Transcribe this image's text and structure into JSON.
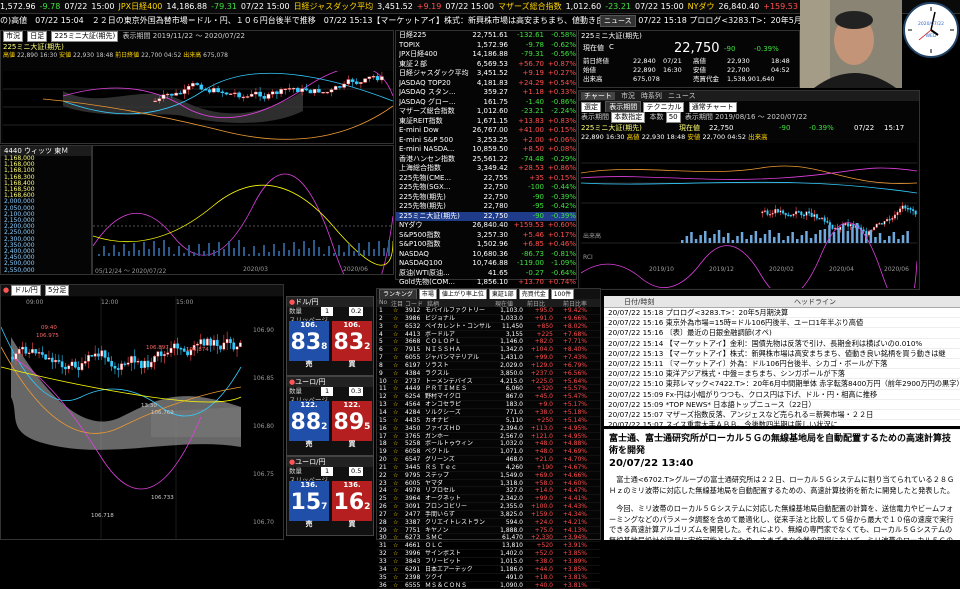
{
  "ticker": [
    {
      "t": "1,572.96",
      "c": "wh"
    },
    {
      "t": "-9.78",
      "c": "dn"
    },
    {
      "t": "07/22",
      "c": "wh"
    },
    {
      "t": "15:00",
      "c": "wh"
    },
    {
      "t": "JPX日経400",
      "c": "yl"
    },
    {
      "t": "14,186.88",
      "c": "wh"
    },
    {
      "t": "-79.31",
      "c": "dn"
    },
    {
      "t": "07/22 15:00",
      "c": "wh"
    },
    {
      "t": "日経ジャスダック平均",
      "c": "yl"
    },
    {
      "t": "3,451.52",
      "c": "wh"
    },
    {
      "t": "+9.19",
      "c": "up"
    },
    {
      "t": "07/22 15:00",
      "c": "wh"
    },
    {
      "t": "マザーズ総合指数",
      "c": "yl"
    },
    {
      "t": "1,012.60",
      "c": "wh"
    },
    {
      "t": "-23.21",
      "c": "dn"
    },
    {
      "t": "07/22 15:00",
      "c": "wh"
    },
    {
      "t": "NYダウ",
      "c": "yl"
    },
    {
      "t": "26,840.40",
      "c": "wh"
    },
    {
      "t": "+159.53",
      "c": "up"
    },
    {
      "t": "07/22 06:00",
      "c": "wh"
    },
    {
      "t": "NASDAQ",
      "c": "yl"
    }
  ],
  "ticker2": "の)高値　07/22 15:04　２２日の東京外国為替市場＝ドル・円、１０６円台後半で推移　07/22 15:13【マーケットアイ】株式：新興株市場は高安まちまち、値動き良い銘柄を買う動きは継",
  "newsbar": {
    "btn": "ニュース",
    "text": "07/22 15:18 プロログ<3283.T>：20年5月期決算"
  },
  "leftchart": {
    "title": "225ミニ大証(期先)",
    "label_ashi": "表示期間",
    "label_date": "2019/11/22 ～ 2020/07/22",
    "vals": [
      "22,890",
      "16:30",
      "22,930",
      "18:48",
      "22,700",
      "04:52",
      "22,750",
      "675,078"
    ],
    "labs": [
      "高値",
      "安値",
      "前日終値",
      "出来高"
    ],
    "dates": [
      "2020/03",
      "2020/06"
    ]
  },
  "leftbox": {
    "title": "4440 ウィッツ 東Ｍ",
    "rows": [
      "1,168,000",
      "1,168,000",
      "1,168,100",
      "1,168,300",
      "1,168,400",
      "1,168,500",
      "1,168,600",
      "2,000,000",
      "2,050,000",
      "2,100,000",
      "2,150,000",
      "2,200,000",
      "2,250,000",
      "2,300,000",
      "2,350,000",
      "2,400,000",
      "2,450,000",
      "2,500,000",
      "2,550,000"
    ]
  },
  "bottomchart": {
    "title": "ドル/円",
    "ashi": "5分足",
    "times": [
      "09:00",
      "12:00",
      "15:00"
    ],
    "prices": [
      "106.90",
      "106.85",
      "106.80",
      "106.75",
      "106.70"
    ],
    "markers": [
      "09:40",
      "106.975",
      "106.897",
      "106.874",
      "13:30",
      "106.769",
      "106.733",
      "106.718"
    ],
    "footer": "05/12/24 ～ 2020/07/22"
  },
  "fx": [
    {
      "pair": "ドル/円",
      "bid_big": "83",
      "bid_small": "8",
      "ask_big": "83",
      "ask_small": "2",
      "bid_pre": "106.",
      "ask_pre": "106.",
      "spread": "0.2",
      "qty": "1"
    },
    {
      "pair": "ユーロ/円",
      "bid_big": "88",
      "bid_small": "2",
      "ask_big": "89",
      "ask_small": "5",
      "bid_pre": "122.",
      "ask_pre": "122.",
      "spread": "0.3",
      "qty": "1"
    },
    {
      "pair": "ユーロ/円",
      "bid_big": "15",
      "bid_small": "7",
      "ask_big": "16",
      "ask_small": "2",
      "bid_pre": "136.",
      "ask_pre": "136.",
      "spread": "0.5",
      "qty": "1"
    }
  ],
  "fx_labels": {
    "qty": "数量",
    "slip": "スリッページ",
    "sell": "売",
    "buy": "買"
  },
  "indices": [
    {
      "n": "日経225",
      "v": "22,751.61",
      "c": "-132.61",
      "p": "-0.58%",
      "d": true
    },
    {
      "n": "TOPIX",
      "v": "1,572.96",
      "c": "-9.78",
      "p": "-0.62%",
      "d": true
    },
    {
      "n": "JPX日経400",
      "v": "14,186.88",
      "c": "-79.31",
      "p": "-0.56%",
      "d": true
    },
    {
      "n": "東証２部",
      "v": "6,569.53",
      "c": "+56.70",
      "p": "+0.87%",
      "d": false
    },
    {
      "n": "日経ジャスダック平均",
      "v": "3,451.52",
      "c": "+9.19",
      "p": "+0.27%",
      "d": false
    },
    {
      "n": "JASDAQ TOP20",
      "v": "4,181.83",
      "c": "+24.29",
      "p": "+0.54%",
      "d": false
    },
    {
      "n": "JASDAQ スタン...",
      "v": "359.27",
      "c": "+1.18",
      "p": "+0.33%",
      "d": false
    },
    {
      "n": "JASDAQ グロー...",
      "v": "161.75",
      "c": "-1.40",
      "p": "-0.86%",
      "d": true
    },
    {
      "n": "マザーズ総合指数",
      "v": "1,012.60",
      "c": "-23.21",
      "p": "-2.24%",
      "d": true
    },
    {
      "n": "東証REIT指数",
      "v": "1,671.15",
      "c": "+13.83",
      "p": "+0.83%",
      "d": false
    },
    {
      "n": "E-mini Dow",
      "v": "26,767.00",
      "c": "+41.00",
      "p": "+0.15%",
      "d": false
    },
    {
      "n": "E-mini S&P 500",
      "v": "3,253.25",
      "c": "+2.00",
      "p": "+0.06%",
      "d": false
    },
    {
      "n": "E-mini NASDA...",
      "v": "10,859.50",
      "c": "+8.50",
      "p": "+0.08%",
      "d": false
    },
    {
      "n": "香港ハンセン指数",
      "v": "25,561.22",
      "c": "-74.48",
      "p": "-0.29%",
      "d": true
    },
    {
      "n": "上海総合指数",
      "v": "3,349.42",
      "c": "+28.53",
      "p": "+0.86%",
      "d": false
    },
    {
      "n": "225先物(CME...",
      "v": "22,755",
      "c": "+35",
      "p": "+0.15%",
      "d": false
    },
    {
      "n": "225先物(SGX...",
      "v": "22,750",
      "c": "-100",
      "p": "-0.44%",
      "d": true
    },
    {
      "n": "225先物(期先)",
      "v": "22,750",
      "c": "-90",
      "p": "-0.39%",
      "d": true
    },
    {
      "n": "225先物(期先)",
      "v": "22,780",
      "c": "-95",
      "p": "-0.42%",
      "d": true
    },
    {
      "n": "225ミニ大証(期先)",
      "v": "22,750",
      "c": "-90",
      "p": "-0.39%",
      "d": true,
      "sel": true
    },
    {
      "n": "NYダウ",
      "v": "26,840.40",
      "c": "+159.53",
      "p": "+0.60%",
      "d": false
    },
    {
      "n": "S&P500指数",
      "v": "3,257.30",
      "c": "+5.46",
      "p": "+0.17%",
      "d": false
    },
    {
      "n": "S&P100指数",
      "v": "1,502.96",
      "c": "+6.85",
      "p": "+0.46%",
      "d": false
    },
    {
      "n": "NASDAQ",
      "v": "10,680.36",
      "c": "-86.73",
      "p": "-0.81%",
      "d": true
    },
    {
      "n": "NASDAQ100",
      "v": "10,746.88",
      "c": "-119.00",
      "p": "-1.09%",
      "d": true
    },
    {
      "n": "原油(WTI原油...",
      "v": "41.65",
      "c": "-0.27",
      "p": "-0.64%",
      "d": true
    },
    {
      "n": "Gold先物(COM...",
      "v": "1,856.10",
      "c": "+13.70",
      "p": "+0.74%",
      "d": false
    }
  ],
  "quote": {
    "title": "225ミニ大証(期先)",
    "labels": [
      "現在値",
      "前日終値",
      "始値",
      "高値",
      "安値",
      "出来高",
      "売買代金"
    ],
    "price": "22,750",
    "chg": "-90",
    "pct": "-0.39%",
    "prev": "22,840",
    "prev_t": "07/21",
    "open": "22,890",
    "open_t": "16:30",
    "high": "22,930",
    "high_t": "18:48",
    "low": "22,700",
    "low_t": "04:52",
    "vol": "675,078",
    "amt": "1,538,901,640",
    "unit": "C",
    "hi_t": "16:30",
    "lo_t": "04:52"
  },
  "rchart": {
    "tabs": [
      "チャート",
      "市況",
      "時系列",
      "ニュース"
    ],
    "sel1": "選定",
    "btn1": "表示期間",
    "sel2": "テクニカル",
    "sel3": "通常チャート",
    "lbl_period": "表示期間",
    "sel4": "本数指定",
    "lbl_count": "本数",
    "count": "50",
    "lbl_range": "表示期間",
    "range": "2019/08/16 ～ 2020/07/22",
    "name": "225ミニ大証(期先)",
    "stats": [
      "現在値",
      "22,750",
      "-90",
      "-0.39%",
      "07/22",
      "15:17"
    ],
    "stats2": [
      "22,890",
      "16:30",
      "高値",
      "22,930",
      "18:48",
      "安値",
      "22,700",
      "04:52",
      "出来高"
    ],
    "vol_lbl": "出来高",
    "rci_lbl": "RCI",
    "dates": [
      "2019/10",
      "2019/12",
      "2020/02",
      "2020/04",
      "2020/06"
    ]
  },
  "rank": {
    "tabs": [
      "ランキング",
      "市場",
      "値上がり率上位",
      "東証1部",
      "売買代金",
      "100件"
    ],
    "cols": [
      "No",
      "注目",
      "コード",
      "銘柄",
      "現在値",
      "前日比",
      "前日比率"
    ],
    "rows": [
      [
        "1",
        "3912",
        "モバイルファクトリー",
        "1,103.0",
        "+95.0",
        "+9.42%"
      ],
      [
        "2",
        "3986",
        "ビジョナル",
        "1,033.0",
        "+91.0",
        "+9.66%"
      ],
      [
        "3",
        "6532",
        "ベイカレント・コンサル",
        "11,450",
        "+850",
        "+8.02%"
      ],
      [
        "4",
        "4413",
        "ボードルア",
        "3,155",
        "+225",
        "+7.68%"
      ],
      [
        "5",
        "3668",
        "ＣＯＬＯＰＬ",
        "1,146.0",
        "+82.0",
        "+7.71%"
      ],
      [
        "6",
        "7915",
        "ＮＩＳＳＨＡ",
        "1,342.0",
        "+104.0",
        "+8.40%"
      ],
      [
        "7",
        "6055",
        "ジャパンマテリアル",
        "1,431.0",
        "+99.0",
        "+7.43%"
      ],
      [
        "8",
        "6197",
        "ソラスト",
        "2,029.0",
        "+129.0",
        "+6.79%"
      ],
      [
        "9",
        "4384",
        "ラクスル",
        "3,850.0",
        "+237.0",
        "+6.56%"
      ],
      [
        "10",
        "2737",
        "トーメンデバイス",
        "4,215.0",
        "+225.0",
        "+5.64%"
      ],
      [
        "11",
        "4449",
        "ＰＲＴＩＭＥＳ",
        "6,060",
        "+320",
        "+5.57%"
      ],
      [
        "12",
        "6254",
        "野村マイクロ",
        "867.0",
        "+45.0",
        "+5.47%"
      ],
      [
        "13",
        "4564",
        "オンコセラピ",
        "183.0",
        "+9.0",
        "+5.17%"
      ],
      [
        "14",
        "4284",
        "ソルクシーズ",
        "771.0",
        "+38.0",
        "+5.18%"
      ],
      [
        "15",
        "4435",
        "カオナビ",
        "5,110",
        "+250",
        "+5.14%"
      ],
      [
        "16",
        "3450",
        "ファイズＨＤ",
        "2,394.0",
        "+113.0",
        "+4.95%"
      ],
      [
        "17",
        "3765",
        "ガンホー",
        "2,567.0",
        "+121.0",
        "+4.95%"
      ],
      [
        "18",
        "5258",
        "ポールトゥウィン",
        "1,032.0",
        "+48.0",
        "+4.88%"
      ],
      [
        "19",
        "6058",
        "ベクトル",
        "1,071.0",
        "+48.0",
        "+4.69%"
      ],
      [
        "20",
        "6547",
        "グリーンズ",
        "468.0",
        "+21.0",
        "+4.70%"
      ],
      [
        "21",
        "3445",
        "ＲＳ Ｔｅｃ",
        "4,260",
        "+190",
        "+4.67%"
      ],
      [
        "22",
        "9795",
        "ステップ",
        "1,549.0",
        "+69.0",
        "+4.66%"
      ],
      [
        "23",
        "6005",
        "ヤマダ",
        "1,318.0",
        "+58.0",
        "+4.60%"
      ],
      [
        "24",
        "4978",
        "リプロセル",
        "327.0",
        "+14.0",
        "+4.47%"
      ],
      [
        "25",
        "3964",
        "オークネット",
        "2,342.0",
        "+99.0",
        "+4.41%"
      ],
      [
        "26",
        "3091",
        "ブロンコビリー",
        "2,355.0",
        "+100.0",
        "+4.43%"
      ],
      [
        "27",
        "2477",
        "手間いらず",
        "3,825.0",
        "+159.0",
        "+4.34%"
      ],
      [
        "28",
        "3387",
        "クリエイトレストラン",
        "594.0",
        "+24.0",
        "+4.21%"
      ],
      [
        "29",
        "7751",
        "キヤノン",
        "1,888.0",
        "+75.0",
        "+4.13%"
      ],
      [
        "30",
        "6273",
        "ＳＭＣ",
        "61,470",
        "+2,330",
        "+3.94%"
      ],
      [
        "31",
        "4661",
        "ＯＬＣ",
        "13,810",
        "+520",
        "+3.91%"
      ],
      [
        "32",
        "3996",
        "サインポスト",
        "1,402.0",
        "+52.0",
        "+3.85%"
      ],
      [
        "33",
        "3843",
        "フリービット",
        "1,015.0",
        "+38.0",
        "+3.89%"
      ],
      [
        "34",
        "6291",
        "日本エアーテック",
        "1,186.0",
        "+44.0",
        "+3.85%"
      ],
      [
        "35",
        "2398",
        "ツクイ",
        "491.0",
        "+18.0",
        "+3.81%"
      ],
      [
        "36",
        "6555",
        "ＭＳ＆ＣＯＮＳ",
        "1,090.0",
        "+40.0",
        "+3.81%"
      ]
    ]
  },
  "news_head": {
    "c1": "日付/時刻",
    "c2": "ヘッドライン"
  },
  "news": [
    "20/07/22 15:18 プロログ<3283.T>：20年5月期決算",
    "20/07/22 15:16 東京外為市場=15時=ドル106円後半、ユーロ1年半ぶり高値",
    "20/07/22 15:16 〔表〕最近の日銀金融調節(オペ)",
    "20/07/22 15:14 【マーケットアイ】金利：国債先物は反落で引け、長期金利は横ばいの0.010%",
    "20/07/22 15:13 【マーケットアイ】株式：新興株市場は高安まちまち、値動き良い銘柄を買う動きは継",
    "20/07/22 15:11 〔マーケットアイ〕外為：ドル106円台後半、シカゴ・ボールが下落",
    "20/07/22 15:10 東洋アジア株式・中盤＝まちまち、シンガポールが下落",
    "20/07/22 15:10 東邦レマック<7422.T>：20年6月中間期単体 赤字転落8400万円（前年2900万円の黒字）、2...",
    "20/07/22 15:09 Fx-円は小幅がりつつも、クロス円は下げ、ドル・円・相高に推移",
    "20/07/22 15:09 *TOP NEWS* 日本語トップニュース（22日）",
    "20/07/22 15:07 マザーズ指数反落、アンジェスなど売られる＝新興市場・２２日",
    "20/07/22 15:07 スイス重電大手ＡＢＢ、今後数四半期は厳しい状況に"
  ],
  "article": {
    "title": "富士通、富士通研究所がローカル５Ｇの無線基地局を自動配置するための高速計算技術を開発",
    "date": "20/07/22 13:40",
    "body1": "　富士通<6702.T>グループの富士通研究所は２２日、ローカル５Ｇシステムに割り当てられている２８ＧＨｚのミリ波帯に対応した無線基地局を自動配置するための、高速計算技術を新たに開発したと発表した。",
    "body2": "　今回、ミリ波帯のローカル５Ｇシステムに対応した無線基地局自動配置の計算を、送信電力やビームフォーミングなどのパラメータ調整を含めて最適化し、従来手法と比較して５倍から最大で１０倍の速度で実行できる高速計算アルゴリズムを開発した。それにより、無線の専門家でなくても、ローカル５Ｇシステムの無線基地局設計が容易に実施可能となるため、さまざまな企業の現場において、ミリ波帯のローカル５Ｇの導入促進につながる。"
  },
  "clock": {
    "date": "2020/07/22",
    "day": "WED"
  },
  "colors": {
    "up": "#ff4d4d",
    "down": "#3ee03e",
    "label": "#ffd400",
    "select": "#1f3c8a"
  }
}
